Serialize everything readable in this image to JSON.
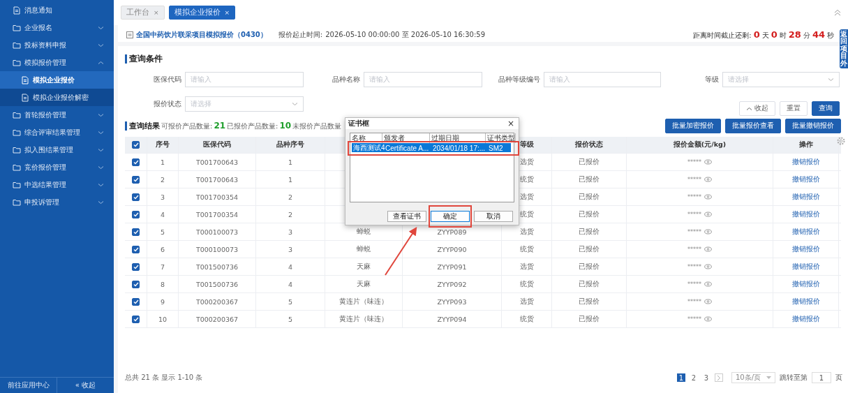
{
  "sidebar": {
    "items": [
      {
        "label": "消息通知",
        "kind": "page",
        "selected": false
      },
      {
        "label": "企业报名",
        "kind": "folder",
        "expanded": false,
        "selected": false
      },
      {
        "label": "投标资料申报",
        "kind": "folder",
        "expanded": false,
        "selected": false
      },
      {
        "label": "模拟报价管理",
        "kind": "folder",
        "expanded": true,
        "selected": false,
        "children": [
          {
            "label": "模拟企业报价",
            "kind": "page",
            "selected": true
          },
          {
            "label": "模拟企业报价解密",
            "kind": "page",
            "selected": false
          }
        ]
      },
      {
        "label": "首轮报价管理",
        "kind": "folder",
        "expanded": false,
        "selected": false
      },
      {
        "label": "综合评审结果管理",
        "kind": "folder",
        "expanded": false,
        "selected": false
      },
      {
        "label": "拟入围结果管理",
        "kind": "folder",
        "expanded": false,
        "selected": false
      },
      {
        "label": "竞价报价管理",
        "kind": "folder",
        "expanded": false,
        "selected": false
      },
      {
        "label": "中选结果管理",
        "kind": "folder",
        "expanded": false,
        "selected": false
      },
      {
        "label": "申投诉管理",
        "kind": "folder",
        "expanded": false,
        "selected": false
      }
    ],
    "footer": {
      "app_center": "前往应用中心",
      "collapse": "« 收起"
    }
  },
  "tabs": [
    {
      "label": "工作台",
      "close": "×",
      "selected": false
    },
    {
      "label": "模拟企业报价",
      "close": "×",
      "selected": true
    }
  ],
  "project": {
    "title": "全国中药饮片联采项目模拟报价（0430）",
    "period_label": "报价起止时间:",
    "period": "2026-05-10 00:00:00 至 2026-05-10 16:30:59",
    "countdown": [
      {
        "text": "距离时间截止还剩:",
        "kind": "label"
      },
      {
        "text": "0",
        "kind": "num"
      },
      {
        "text": "天",
        "kind": "unit"
      },
      {
        "text": "0",
        "kind": "num"
      },
      {
        "text": "时",
        "kind": "unit"
      },
      {
        "text": "28",
        "kind": "num"
      },
      {
        "text": "分",
        "kind": "unit"
      },
      {
        "text": "44",
        "kind": "num"
      },
      {
        "text": "秒",
        "kind": "unit"
      }
    ]
  },
  "side_tab": "返回项目外",
  "query": {
    "title": "查询条件",
    "fields": [
      {
        "label": "医保代码",
        "placeholder": "请输入",
        "kind": "input"
      },
      {
        "label": "品种名称",
        "placeholder": "请输入",
        "kind": "input"
      },
      {
        "label": "品种等级编号",
        "placeholder": "请输入",
        "kind": "input"
      },
      {
        "label": "等级",
        "placeholder": "请选择",
        "kind": "select"
      },
      {
        "label": "报价状态",
        "placeholder": "请选择",
        "kind": "select"
      }
    ],
    "buttons": [
      {
        "label": "收起",
        "kind": "collapse"
      },
      {
        "label": "重置",
        "kind": "plain"
      },
      {
        "label": "查询",
        "kind": "primary"
      }
    ]
  },
  "results": {
    "title": "查询结果",
    "stats": [
      {
        "label": "可报价产品数量:",
        "value": "21"
      },
      {
        "label": "已报价产品数量:",
        "value": "10"
      },
      {
        "label": "未报价产品数量"
      }
    ],
    "buttons": [
      "批量加密报价",
      "批量报价查看",
      "批量撤销报价"
    ]
  },
  "table": {
    "all_checked": true,
    "columns": [
      "序号",
      "医保代码",
      "品种序号",
      null,
      null,
      "等级",
      "报价状态",
      "报价金额(元/kg)",
      "操作"
    ],
    "rows": [
      {
        "checked": true,
        "cells": [
          "1",
          "T001700643",
          "1",
          null,
          null,
          "选货",
          "已报价",
          "*****",
          "撤销报价"
        ]
      },
      {
        "checked": true,
        "cells": [
          "2",
          "T001700643",
          "1",
          null,
          null,
          "统货",
          "已报价",
          "*****",
          "撤销报价"
        ]
      },
      {
        "checked": true,
        "cells": [
          "3",
          "T001700354",
          "2",
          null,
          null,
          "选货",
          "已报价",
          "*****",
          "撤销报价"
        ]
      },
      {
        "checked": true,
        "cells": [
          "4",
          "T001700354",
          "2",
          null,
          null,
          "统货",
          "已报价",
          "*****",
          "撤销报价"
        ]
      },
      {
        "checked": true,
        "cells": [
          "5",
          "T000100073",
          "3",
          "蝉蜕",
          "ZYYP089",
          "选货",
          "已报价",
          "*****",
          "撤销报价"
        ]
      },
      {
        "checked": true,
        "cells": [
          "6",
          "T000100073",
          "3",
          "蝉蜕",
          "ZYYP090",
          "统货",
          "已报价",
          "*****",
          "撤销报价"
        ]
      },
      {
        "checked": true,
        "cells": [
          "7",
          "T001500736",
          "4",
          "天麻",
          "ZYYP091",
          "选货",
          "已报价",
          "*****",
          "撤销报价"
        ]
      },
      {
        "checked": true,
        "cells": [
          "8",
          "T001500736",
          "4",
          "天麻",
          "ZYYP092",
          "统货",
          "已报价",
          "*****",
          "撤销报价"
        ]
      },
      {
        "checked": true,
        "cells": [
          "9",
          "T000200367",
          "5",
          "黄连片（味连）",
          "ZYYP093",
          "选货",
          "已报价",
          "*****",
          "撤销报价"
        ]
      },
      {
        "checked": true,
        "cells": [
          "10",
          "T000200367",
          "5",
          "黄连片（味连）",
          "ZYYP094",
          "统货",
          "已报价",
          "*****",
          "撤销报价"
        ]
      }
    ]
  },
  "pagination": {
    "summary": "总共 21 条 显示 1-10 条",
    "pages": [
      {
        "label": "1",
        "selected": true
      },
      {
        "label": "2",
        "selected": false
      },
      {
        "label": "3",
        "selected": false
      }
    ],
    "page_size": "10条/页",
    "jump_label": "跳转至第",
    "jump_value": "1",
    "jump_unit": "页"
  },
  "dialog": {
    "title": "证书框",
    "close": "×",
    "columns": [
      "名称",
      "颁发者",
      "过期日期",
      "证书类型"
    ],
    "rows": [
      {
        "selected": true,
        "cells": [
          "海西测试4",
          "Certificate A...",
          "2034/01/18 17:...",
          "SM2"
        ]
      }
    ],
    "buttons": [
      {
        "label": "查看证书",
        "highlighted": false
      },
      {
        "label": "确定",
        "highlighted": true
      },
      {
        "label": "取消",
        "highlighted": false
      }
    ]
  }
}
